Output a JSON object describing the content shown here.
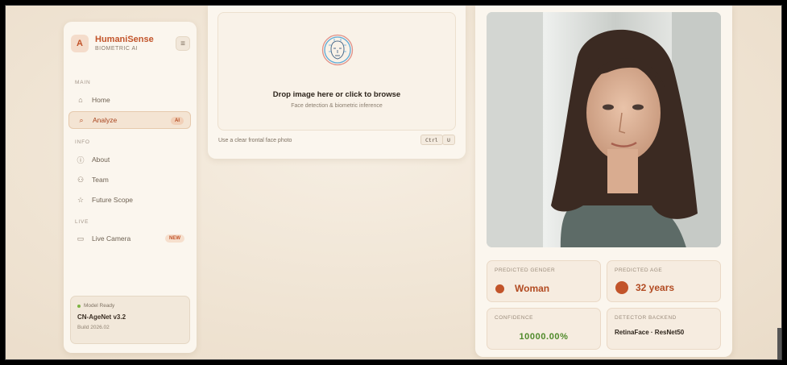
{
  "brand": {
    "logo_glyph": "A",
    "name": "HumaniSense",
    "subtitle": "BIOMETRIC AI",
    "menu_glyph": "≡"
  },
  "sidebar": {
    "sections": {
      "main": "MAIN",
      "info": "INFO",
      "live": "LIVE"
    },
    "items": [
      {
        "label": "Home",
        "icon": "home-icon",
        "glyph": "⌂"
      },
      {
        "label": "Analyze",
        "icon": "search-icon",
        "glyph": "⌕",
        "badge": "AI"
      },
      {
        "label": "About",
        "icon": "info-icon",
        "glyph": "ⓘ"
      },
      {
        "label": "Team",
        "icon": "team-icon",
        "glyph": "⚇"
      },
      {
        "label": "Future Scope",
        "icon": "star-icon",
        "glyph": "☆"
      },
      {
        "label": "Live Camera",
        "icon": "camera-icon",
        "glyph": "▭",
        "badge": "NEW"
      }
    ],
    "model": {
      "status": "Model Ready",
      "name": "CN-AgeNet v3.2",
      "build": "Build 2026.02"
    }
  },
  "upload": {
    "title": "Drop image here or click to browse",
    "subtitle": "Face detection & biometric inference",
    "hint": "Use a clear frontal face photo",
    "kbd": [
      "Ctrl",
      "U"
    ]
  },
  "result": {
    "gender": {
      "label": "PREDICTED GENDER",
      "value": "Woman"
    },
    "age": {
      "label": "PREDICTED AGE",
      "value": "32 years"
    },
    "confidence": {
      "label": "CONFIDENCE",
      "value": "10000.00%"
    },
    "backend": {
      "label": "DETECTOR BACKEND",
      "value": "RetinaFace · ResNet50"
    }
  },
  "colors": {
    "accent": "#c2542a",
    "success": "#4f8a2a",
    "background": "#efe3d2"
  }
}
